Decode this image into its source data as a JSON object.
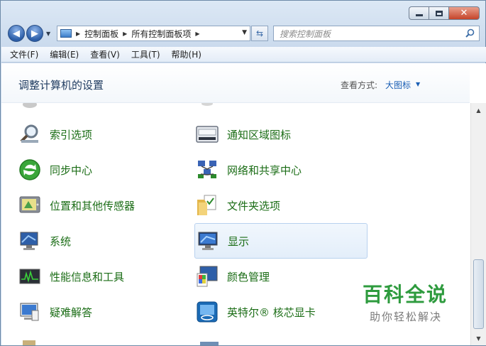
{
  "address": {
    "crumbs": [
      "控制面板",
      "所有控制面板项"
    ]
  },
  "search": {
    "placeholder": "搜索控制面板"
  },
  "menu": [
    "文件(F)",
    "编辑(E)",
    "查看(V)",
    "工具(T)",
    "帮助(H)"
  ],
  "header": {
    "title": "调整计算机的设置",
    "view_label": "查看方式:",
    "view_value": "大图标"
  },
  "items": [
    {
      "label": "索引选项",
      "icon": "magnifier-icon"
    },
    {
      "label": "通知区域图标",
      "icon": "notification-tray-icon"
    },
    {
      "label": "同步中心",
      "icon": "sync-icon"
    },
    {
      "label": "网络和共享中心",
      "icon": "network-icon"
    },
    {
      "label": "位置和其他传感器",
      "icon": "sensor-icon"
    },
    {
      "label": "文件夹选项",
      "icon": "folder-options-icon"
    },
    {
      "label": "系统",
      "icon": "system-icon"
    },
    {
      "label": "显示",
      "icon": "display-icon"
    },
    {
      "label": "性能信息和工具",
      "icon": "performance-icon"
    },
    {
      "label": "颜色管理",
      "icon": "color-management-icon"
    },
    {
      "label": "疑难解答",
      "icon": "troubleshooting-icon"
    },
    {
      "label": "英特尔® 核芯显卡",
      "icon": "intel-graphics-icon"
    }
  ],
  "selected_item": "显示",
  "watermark": {
    "title": "百科全说",
    "subtitle": "助你轻松解决"
  },
  "colors": {
    "item_text": "#1b6d16",
    "accent": "#1a5fb4",
    "watermark": "#2e9b3e"
  }
}
